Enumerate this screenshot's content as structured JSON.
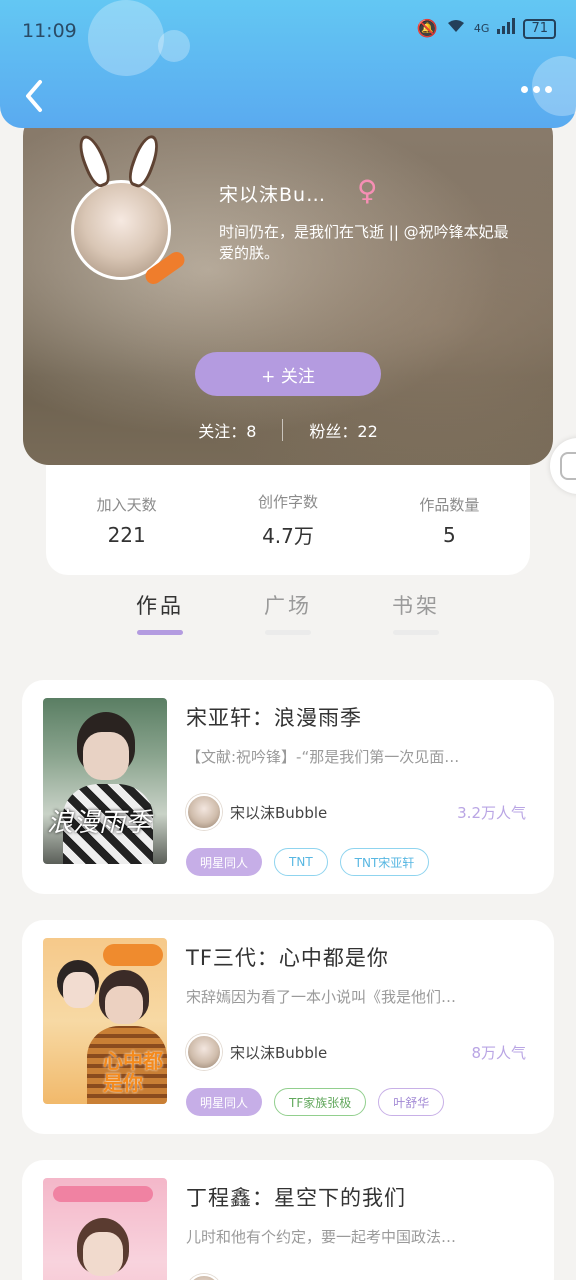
{
  "status_bar": {
    "time": "11:09",
    "network": "4G",
    "battery": "71"
  },
  "header": {
    "back_icon": "chevron-left-icon",
    "more_icon": "more-dots-icon"
  },
  "profile": {
    "name": "宋以沫Bu…",
    "gender_symbol": "♀",
    "bio": "时间仍在，是我们在飞逝 || @祝吟锋本妃最爱的朕。",
    "follow_button": "+ 关注",
    "following_label": "关注：8",
    "followers_label": "粉丝：22"
  },
  "stats": [
    {
      "label": "加入天数",
      "value": "221"
    },
    {
      "label": "创作字数",
      "value": "4.7万"
    },
    {
      "label": "作品数量",
      "value": "5"
    }
  ],
  "tabs": [
    {
      "label": "作品",
      "active": true
    },
    {
      "label": "广场",
      "active": false
    },
    {
      "label": "书架",
      "active": false
    }
  ],
  "works": [
    {
      "title": "宋亚轩：浪漫雨季",
      "desc": "【文献:祝吟锋】-“那是我们第一次见面…",
      "author": "宋以沫Bubble",
      "popularity": "3.2万人气",
      "tags": [
        "明星同人",
        "TNT",
        "TNT宋亚轩"
      ],
      "cover_text": "浪漫雨季"
    },
    {
      "title": "TF三代：心中都是你",
      "desc": "宋辞嫣因为看了一本小说叫《我是他们…",
      "author": "宋以沫Bubble",
      "popularity": "8万人气",
      "tags": [
        "明星同人",
        "TF家族张极",
        "叶舒华"
      ],
      "cover_text": "心中都是你"
    },
    {
      "title": "丁程鑫：星空下的我们",
      "desc": "儿时和他有个约定，要一起考中国政法…",
      "author": "",
      "popularity": "",
      "tags": [],
      "cover_text": ""
    }
  ],
  "colors": {
    "header": "#5aaaf0",
    "accent": "#b49be0",
    "tag_blue": "#8fd4ef",
    "tag_green": "#92cf8e"
  }
}
